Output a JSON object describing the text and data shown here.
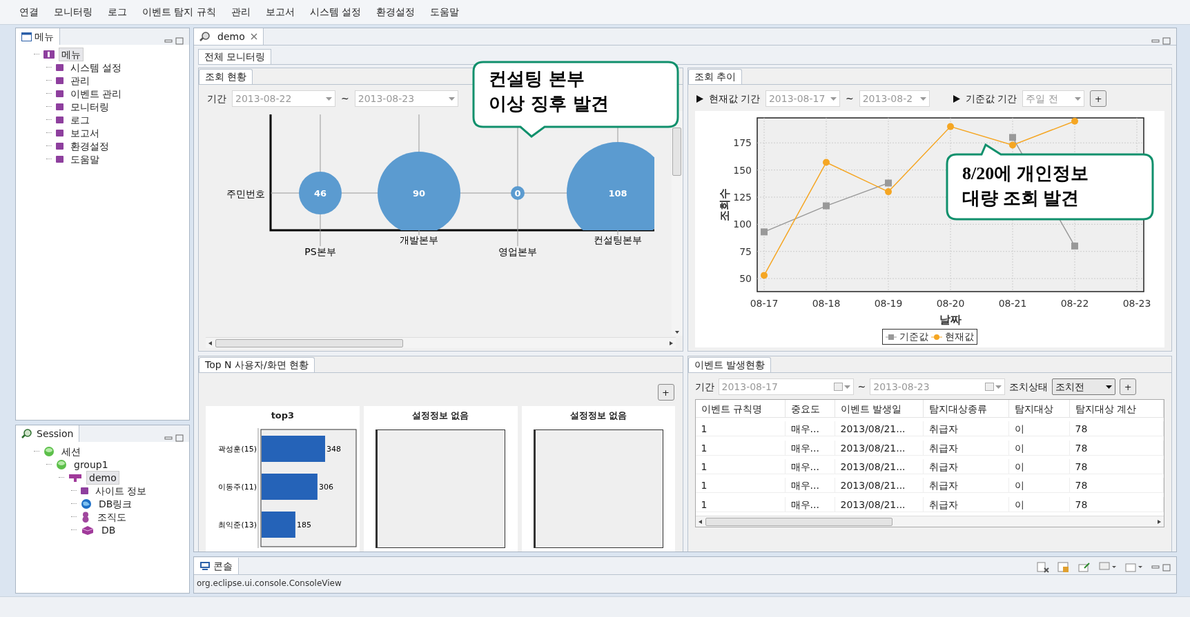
{
  "menu_bar": [
    "연결",
    "모니터링",
    "로그",
    "이벤트 탐지 규칙",
    "관리",
    "보고서",
    "시스템 설정",
    "환경설정",
    "도움말"
  ],
  "menu_panel": {
    "title": "메뉴",
    "tree": [
      {
        "label": "메뉴",
        "selected": true,
        "children": [
          {
            "label": "시스템 설정",
            "selected": false
          },
          {
            "label": "관리",
            "selected": false
          },
          {
            "label": "이벤트 관리",
            "selected": false
          },
          {
            "label": "모니터링",
            "selected": false
          },
          {
            "label": "로그",
            "selected": false
          },
          {
            "label": "보고서",
            "selected": false
          },
          {
            "label": "환경설정",
            "selected": false
          },
          {
            "label": "도움말",
            "selected": false
          }
        ]
      }
    ]
  },
  "session_panel": {
    "title": "Session",
    "tree": [
      {
        "label": "세션",
        "selected": false,
        "children": [
          {
            "label": "group1",
            "selected": false,
            "children": [
              {
                "label": "demo",
                "selected": true,
                "children": [
                  {
                    "label": "사이트 정보",
                    "selected": false
                  },
                  {
                    "label": "DB링크",
                    "selected": false
                  },
                  {
                    "label": "조직도",
                    "selected": false
                  },
                  {
                    "label": "DB",
                    "selected": false
                  }
                ]
              }
            ]
          }
        ]
      }
    ]
  },
  "editor_tab": {
    "label": "demo",
    "selected": true
  },
  "sub_tab": {
    "label": "전체 모니터링",
    "selected": true
  },
  "lookup_status": {
    "tab": "조회 현황",
    "period_label": "기간",
    "from": "2013-08-22",
    "separator": "~",
    "to": "2013-08-23",
    "callout": [
      "컨설팅 본부",
      "이상 징후 발견"
    ],
    "row_label": "주민번호",
    "bubbles": [
      {
        "category": "PS본부",
        "label": "46"
      },
      {
        "category": "개발본부",
        "label": "90"
      },
      {
        "category": "영업본부",
        "label": "0"
      },
      {
        "category": "컨설팅본부",
        "label": "108"
      }
    ]
  },
  "lookup_trend": {
    "tab": "조회 추이",
    "current_label": "현재값 기간",
    "from": "2013-08-17",
    "separator": "~",
    "to": "2013-08-2",
    "base_label": "기준값 기간",
    "base_value": "주일 전",
    "add_button": "+",
    "callout": [
      "8/20에 개인정보",
      "대량 조회 발견"
    ],
    "chart_data": {
      "type": "line",
      "grid": true,
      "xlabel": "날짜",
      "ylabel": "조회수",
      "categories": [
        "08-17",
        "08-18",
        "08-19",
        "08-20",
        "08-21",
        "08-22",
        "08-23"
      ],
      "ylim": [
        38,
        198
      ],
      "yticks": [
        50,
        75,
        100,
        125,
        150,
        175
      ],
      "series": [
        {
          "name": "기준값",
          "color": "#999999",
          "marker": "square",
          "values": [
            93,
            117,
            138,
            null,
            180,
            80,
            null
          ]
        },
        {
          "name": "현재값",
          "color": "#f5a623",
          "marker": "circle",
          "values": [
            53,
            157,
            130,
            190,
            173,
            195,
            null
          ]
        }
      ]
    }
  },
  "top_n": {
    "tab": "Top N 사용자/화면 현황",
    "add_button": "+",
    "charts": [
      {
        "title": "top3",
        "chart_data": {
          "type": "bar",
          "orientation": "horizontal",
          "categories": [
            "곽성훈(15)",
            "이동주(11)",
            "최익준(13)"
          ],
          "values": [
            348,
            306,
            185
          ],
          "data_labels": true
        }
      },
      {
        "title": "설정정보 없음"
      },
      {
        "title": "설정정보 없음"
      }
    ]
  },
  "events": {
    "tab": "이벤트 발생현황",
    "period_label": "기간",
    "from": "2013-08-17",
    "separator": "~",
    "to": "2013-08-23",
    "status_label": "조치상태",
    "status_value": "조치전",
    "add_button": "+",
    "table": {
      "columns": [
        "이벤트 규칙명",
        "중요도",
        "이벤트 발생일",
        "탐지대상종류",
        "탐지대상",
        "탐지대상 계산"
      ],
      "rows": [
        [
          "1",
          "매우...",
          "2013/08/21...",
          "취급자",
          "이",
          "78"
        ],
        [
          "1",
          "매우...",
          "2013/08/21...",
          "취급자",
          "이",
          "78"
        ],
        [
          "1",
          "매우...",
          "2013/08/21...",
          "취급자",
          "이",
          "78"
        ],
        [
          "1",
          "매우...",
          "2013/08/21...",
          "취급자",
          "이",
          "78"
        ],
        [
          "1",
          "매우...",
          "2013/08/21...",
          "취급자",
          "이",
          "78"
        ]
      ]
    }
  },
  "console": {
    "tab": "콘솔",
    "text": "org.eclipse.ui.console.ConsoleView"
  }
}
